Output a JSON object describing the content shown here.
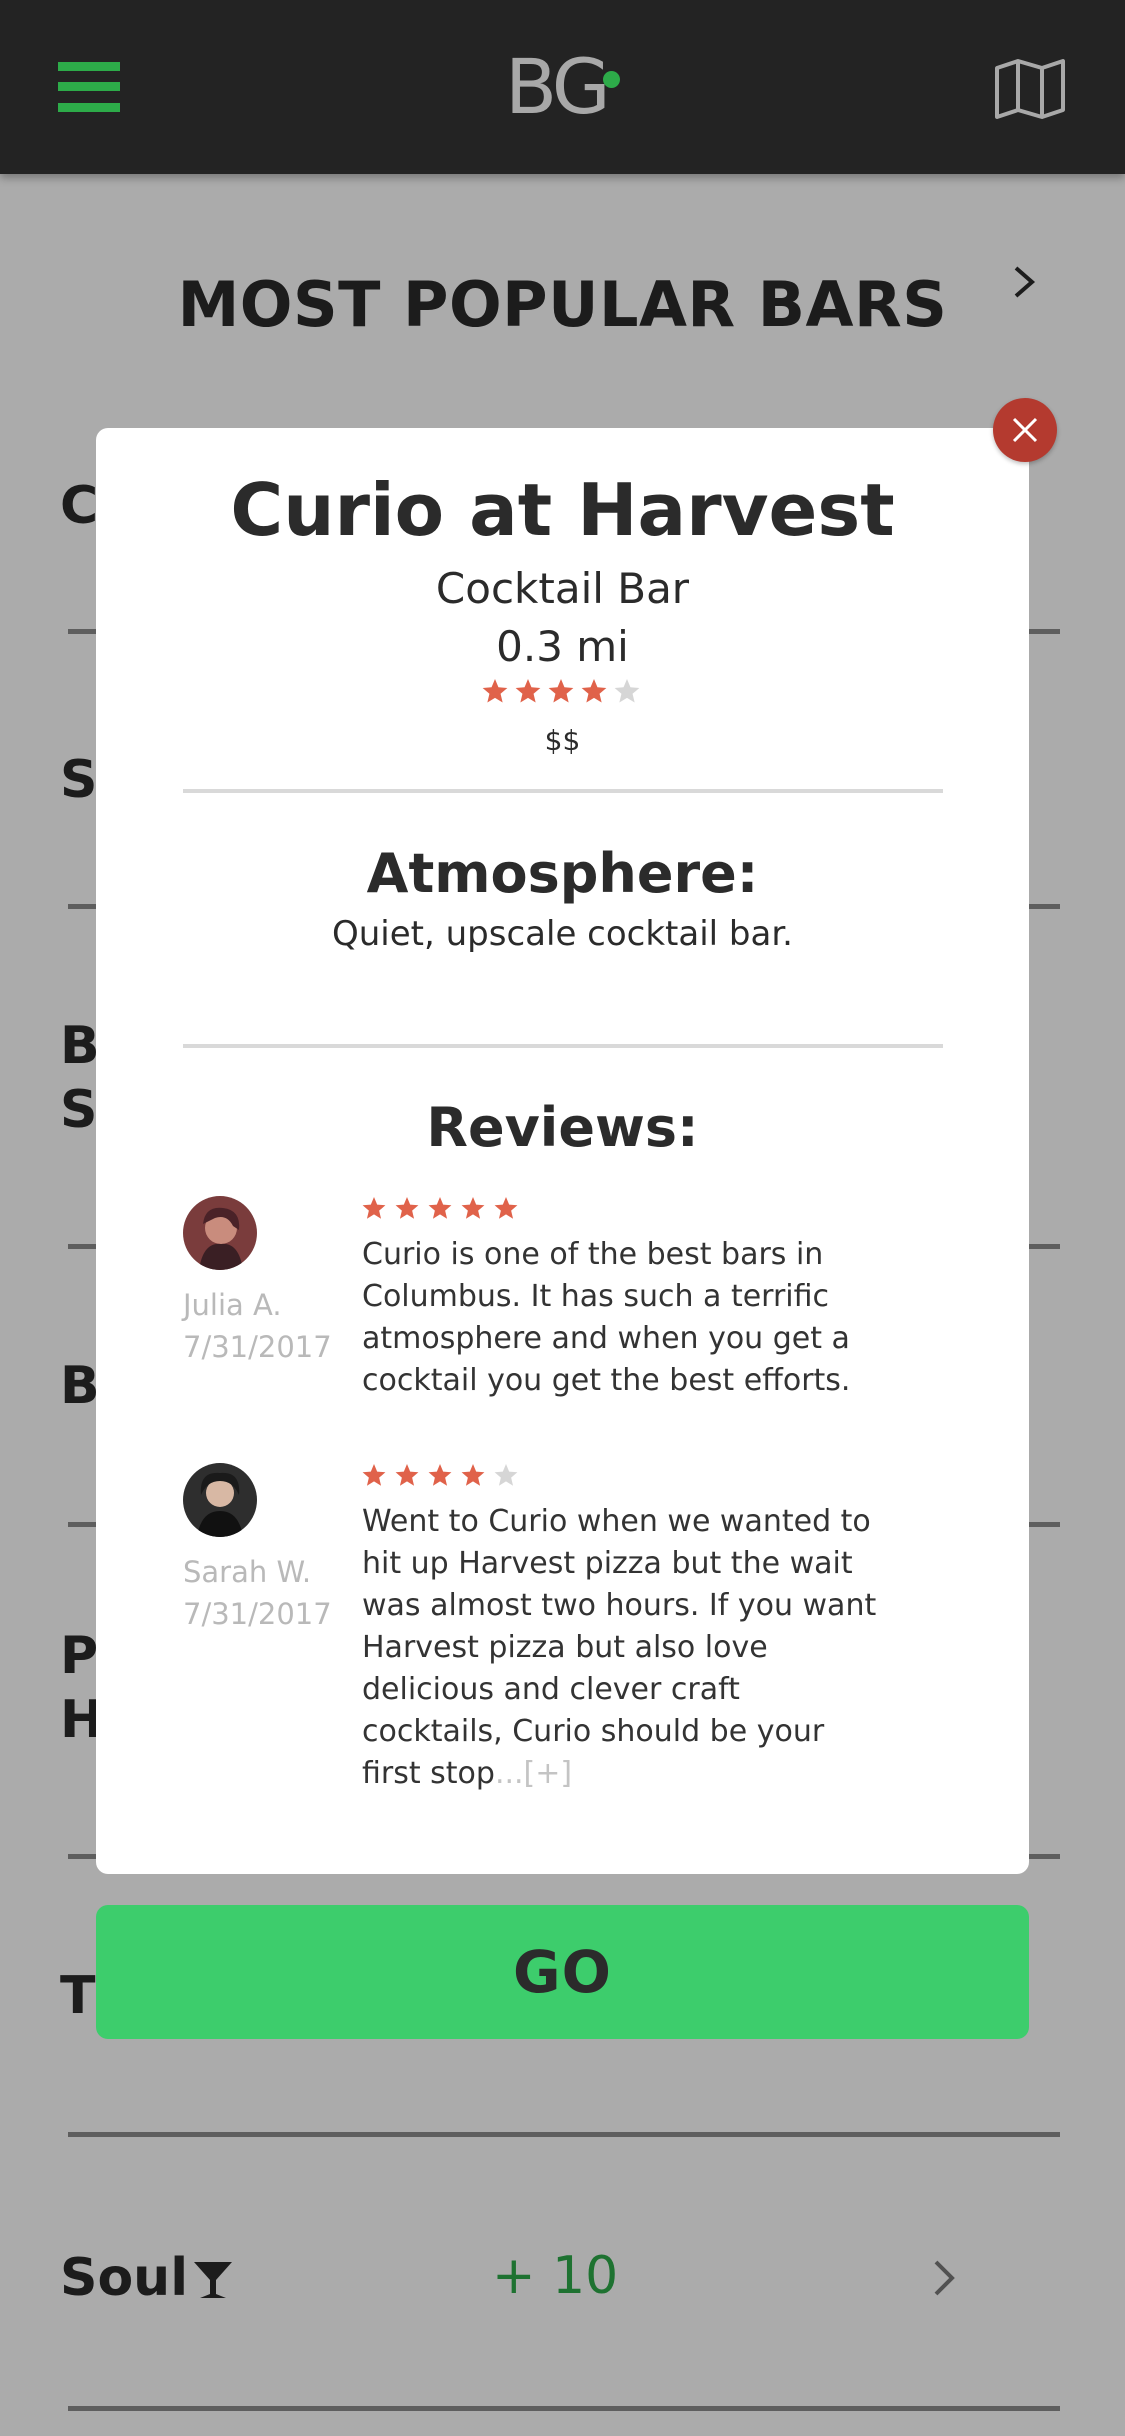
{
  "header": {
    "logo_text": "BG",
    "menu_icon": "hamburger-menu-icon",
    "map_icon": "map-icon",
    "accent_color": "#2dab49"
  },
  "list": {
    "title": "MOST POPULAR BARS",
    "rows": [
      {
        "name": "C"
      },
      {
        "name": "So"
      },
      {
        "name": "B\nSl"
      },
      {
        "name": "B"
      },
      {
        "name": "P\nH"
      },
      {
        "name": "Tl"
      },
      {
        "name": "Soul",
        "badge": "+ 10",
        "icon": "cocktail-glass-icon"
      }
    ]
  },
  "modal": {
    "name": "Curio at Harvest",
    "type": "Cocktail Bar",
    "distance": "0.3 mi",
    "rating": 4,
    "rating_max": 5,
    "price": "$$",
    "atmosphere_heading": "Atmosphere:",
    "atmosphere_text": "Quiet, upscale cocktail bar.",
    "reviews_heading": "Reviews:",
    "reviews": [
      {
        "name": "Julia A.",
        "date": "7/31/2017",
        "rating": 5,
        "text": "Curio is one of the best bars in Columbus. It has such a terrific atmosphere and when you get a cocktail you get the best efforts.",
        "more": ""
      },
      {
        "name": "Sarah W.",
        "date": "7/31/2017",
        "rating": 4,
        "text": "Went to Curio when we wanted to hit up Harvest pizza but the wait was almost two hours. If you want Harvest pizza but also love delicious and clever craft cocktails, Curio should be your first stop",
        "more": "...[+]"
      }
    ],
    "close_icon": "close-icon",
    "star_color": "#e0624a",
    "star_empty_color": "#d6d6d6"
  },
  "go_button": {
    "label": "GO",
    "color": "#3dcd6c"
  }
}
